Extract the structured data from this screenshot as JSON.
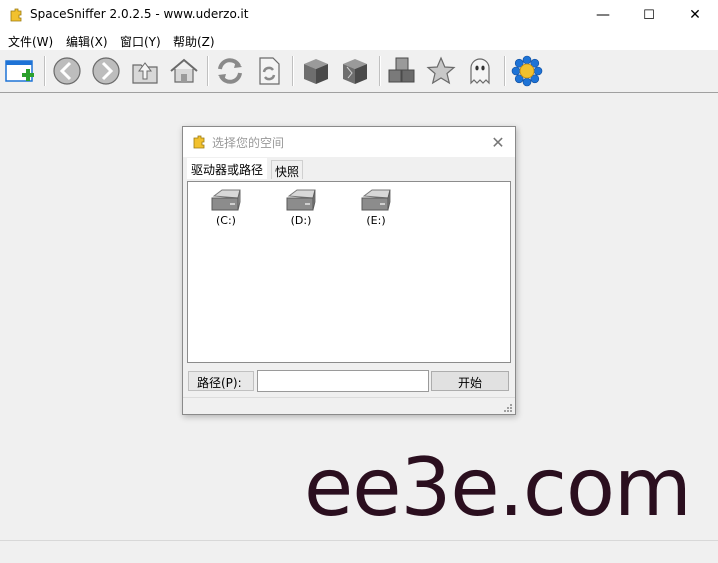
{
  "window": {
    "title": "SpaceSniffer 2.0.2.5 - www.uderzo.it",
    "minimize": "—",
    "maximize": "☐",
    "close": "✕"
  },
  "menu": {
    "items": [
      "文件(W)",
      "编辑(X)",
      "窗口(Y)",
      "帮助(Z)"
    ]
  },
  "toolbar": {
    "icons": [
      "new-view-icon",
      "back-icon",
      "forward-icon",
      "up-folder-icon",
      "home-icon",
      "refresh-icon",
      "refresh-document-icon",
      "cube-icon",
      "cube-broken-icon",
      "cubes-icon",
      "star-icon",
      "ghost-icon",
      "settings-flower-icon"
    ]
  },
  "dialog": {
    "title": "选择您的空间",
    "close": "✕",
    "tabs": [
      {
        "label": "驱动器或路径",
        "active": true
      },
      {
        "label": "快照",
        "active": false
      }
    ],
    "drives": [
      "(C:)",
      "(D:)",
      "(E:)"
    ],
    "path_label": "路径(P):",
    "path_value": "",
    "start_button": "开始"
  },
  "watermark": "ee3e.com",
  "colors": {
    "background": "#f0f0f0",
    "accent_blue": "#1e73d6",
    "watermark": "#2b0f1f"
  }
}
